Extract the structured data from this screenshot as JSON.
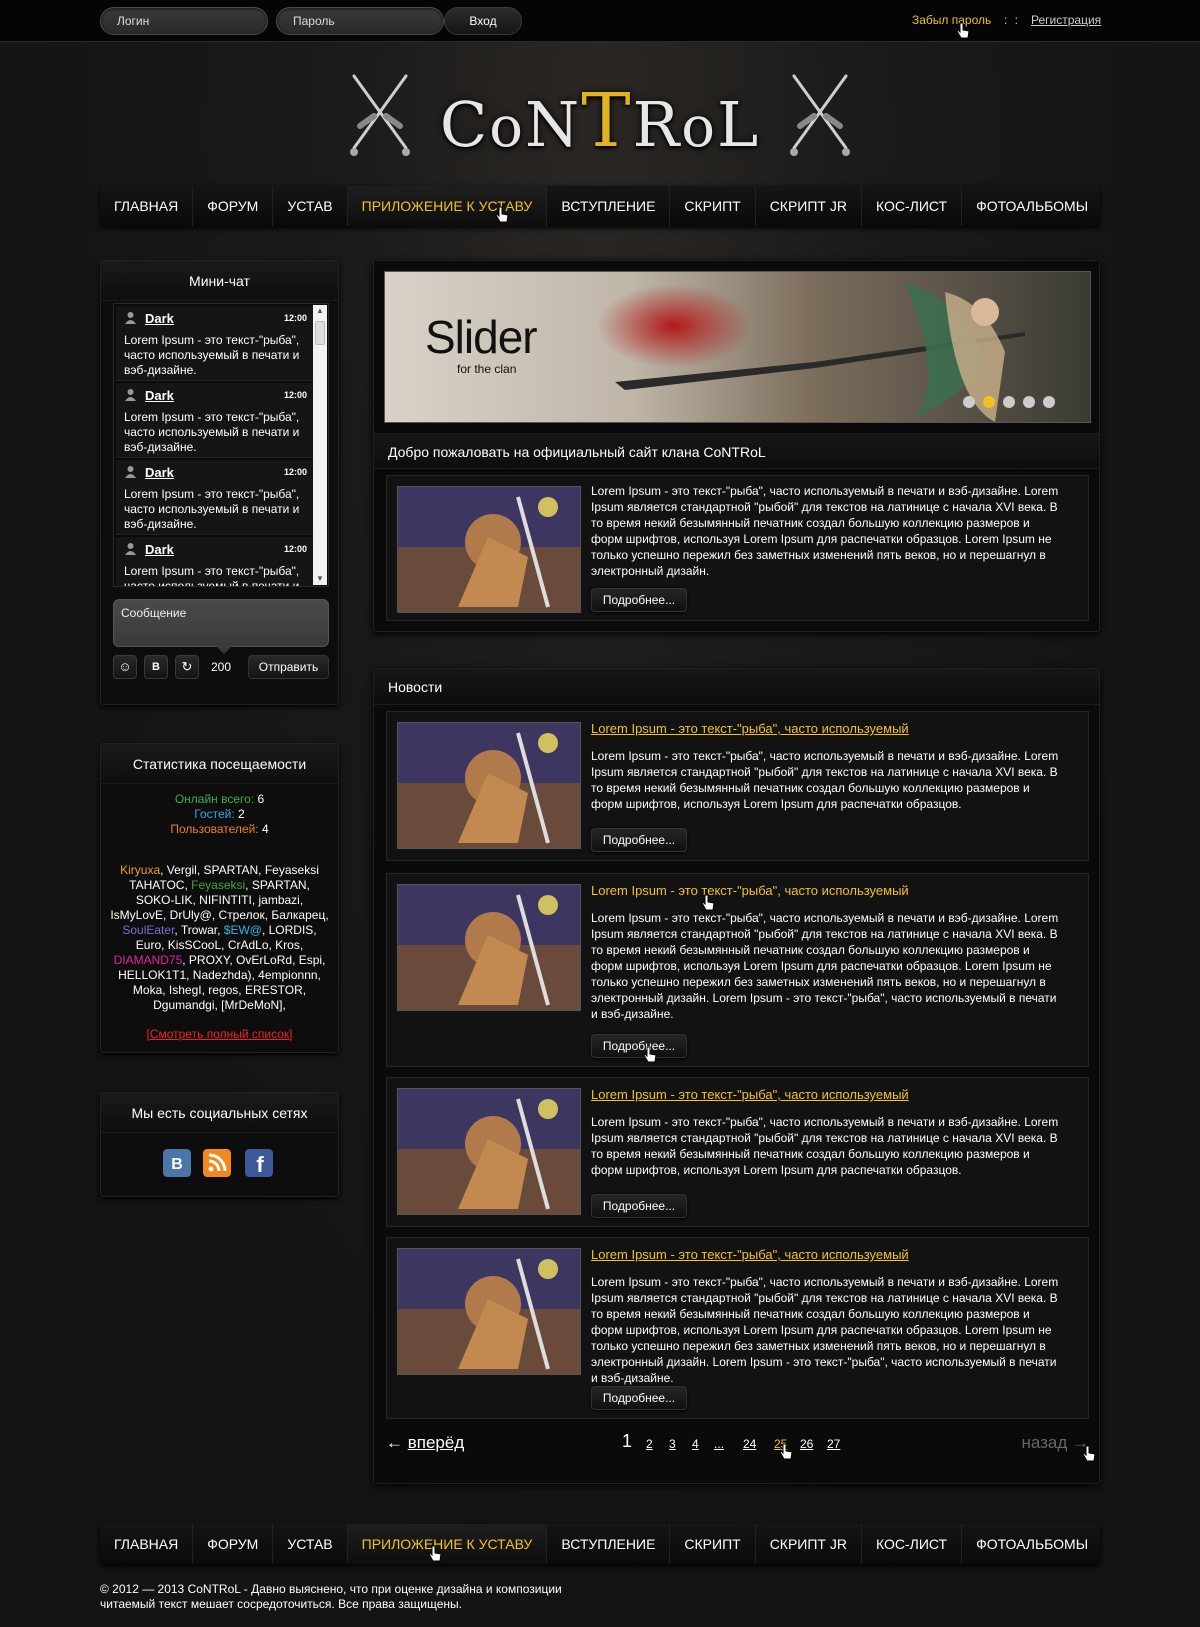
{
  "topbar": {
    "login_placeholder": "Логин",
    "password_placeholder": "Пароль",
    "login_button": "Вход",
    "forgot_password": "Забыл пароль",
    "separator": ": :",
    "register": "Регистрация"
  },
  "logo": {
    "text": "CoNTRoL"
  },
  "nav": {
    "items": [
      "ГЛАВНАЯ",
      "ФОРУМ",
      "УСТАВ",
      "ПРИЛОЖЕНИЕ К УСТАВУ",
      "ВСТУПЛЕНИЕ",
      "СКРИПТ",
      "СКРИПТ JR",
      "КОС-ЛИСТ",
      "ФОТОАЛЬБОМЫ"
    ],
    "active_index": 3
  },
  "minichat": {
    "title": "Мини-чат",
    "messages": [
      {
        "user": "Dark",
        "time": "12:00",
        "text": "Lorem Ipsum - это текст-\"рыба\", часто используемый в печати и вэб-дизайне."
      },
      {
        "user": "Dark",
        "time": "12:00",
        "text": "Lorem Ipsum - это текст-\"рыба\", часто используемый в печати и вэб-дизайне."
      },
      {
        "user": "Dark",
        "time": "12:00",
        "text": "Lorem Ipsum - это текст-\"рыба\", часто используемый в печати и вэб-дизайне."
      },
      {
        "user": "Dark",
        "time": "12:00",
        "text": "Lorem Ipsum - это текст-\"рыба\", часто используемый в печати и вэб-дизайне."
      }
    ],
    "message_placeholder": "Сообщение",
    "char_count": "200",
    "send_button": "Отправить"
  },
  "stats": {
    "title": "Статистика посещаемости",
    "online_label": "Онлайн всего:",
    "online_value": "6",
    "guests_label": "Гостей:",
    "guests_value": "2",
    "users_label": "Пользователей:",
    "users_value": "4",
    "full_list_link": "[Смотреть полный список]"
  },
  "social": {
    "title": "Мы есть социальных сетях",
    "icons": [
      "vk-icon",
      "rss-icon",
      "facebook-icon"
    ]
  },
  "slider": {
    "title": "Slider",
    "subtitle": "for the clan",
    "dots": 5,
    "active_dot": 1
  },
  "welcome": {
    "title": "Добро пожаловать на официальный сайт клана CoNTRoL",
    "text": "Lorem Ipsum - это текст-\"рыба\", часто используемый в печати и вэб-дизайне. Lorem Ipsum является стандартной \"рыбой\" для текстов на латинице с начала XVI века. В то время некий безымянный печатник создал большую коллекцию размеров и форм шрифтов, используя Lorem Ipsum для распечатки образцов. Lorem Ipsum не только успешно пережил без заметных изменений пять веков, но и перешагнул в электронный дизайн.",
    "more_button": "Подробнее..."
  },
  "news": {
    "title": "Новости",
    "items": [
      {
        "title": "Lorem Ipsum - это текст-\"рыба\", часто используемый",
        "text": "Lorem Ipsum - это текст-\"рыба\", часто используемый в печати и вэб-дизайне. Lorem Ipsum является стандартной \"рыбой\" для текстов на латинице с начала XVI века. В то время некий безымянный печатник создал большую коллекцию размеров и форм шрифтов, используя Lorem Ipsum для распечатки образцов.",
        "more": "Подробнее..."
      },
      {
        "title": "Lorem Ipsum - это текст-\"рыба\", часто используемый",
        "text": "Lorem Ipsum - это текст-\"рыба\", часто используемый в печати и вэб-дизайне. Lorem Ipsum является стандартной \"рыбой\" для текстов на латинице с начала XVI века. В то время некий безымянный печатник создал большую коллекцию размеров и форм шрифтов, используя Lorem Ipsum для распечатки образцов. Lorem Ipsum не только успешно пережил без заметных изменений пять веков, но и перешагнул в электронный дизайн. Lorem Ipsum - это текст-\"рыба\", часто используемый в печати и вэб-дизайне.",
        "more": "Подробнее..."
      },
      {
        "title": "Lorem Ipsum - это текст-\"рыба\", часто используемый",
        "text": "Lorem Ipsum - это текст-\"рыба\", часто используемый в печати и вэб-дизайне. Lorem Ipsum является стандартной \"рыбой\" для текстов на латинице с начала XVI века. В то время некий безымянный печатник создал большую коллекцию размеров и форм шрифтов, используя Lorem Ipsum для распечатки образцов.",
        "more": "Подробнее..."
      },
      {
        "title": "Lorem Ipsum - это текст-\"рыба\", часто используемый",
        "text": "Lorem Ipsum - это текст-\"рыба\", часто используемый в печати и вэб-дизайне. Lorem Ipsum является стандартной \"рыбой\" для текстов на латинице с начала XVI века. В то время некий безымянный печатник создал большую коллекцию размеров и форм шрифтов, используя Lorem Ipsum для распечатки образцов. Lorem Ipsum не только успешно пережил без заметных изменений пять веков, но и перешагнул в электронный дизайн. Lorem Ipsum - это текст-\"рыба\", часто используемый в печати и вэб-дизайне.",
        "more": "Подробнее..."
      }
    ]
  },
  "pager": {
    "forward": "вперёд",
    "back": "назад",
    "pages": [
      "1",
      "2",
      "3",
      "4",
      "...",
      "24",
      "25",
      "26",
      "27"
    ],
    "current": "1",
    "highlighted": "25"
  },
  "footer": {
    "text": "© 2012 — 2013 CoNTRoL - Давно выяснено, что при оценке дизайна и композиции читаемый текст мешает сосредоточиться. Все права защищены."
  },
  "colors": {
    "accent": "#f3c21d",
    "background": "#161616",
    "panel": "#0a0a0a"
  }
}
